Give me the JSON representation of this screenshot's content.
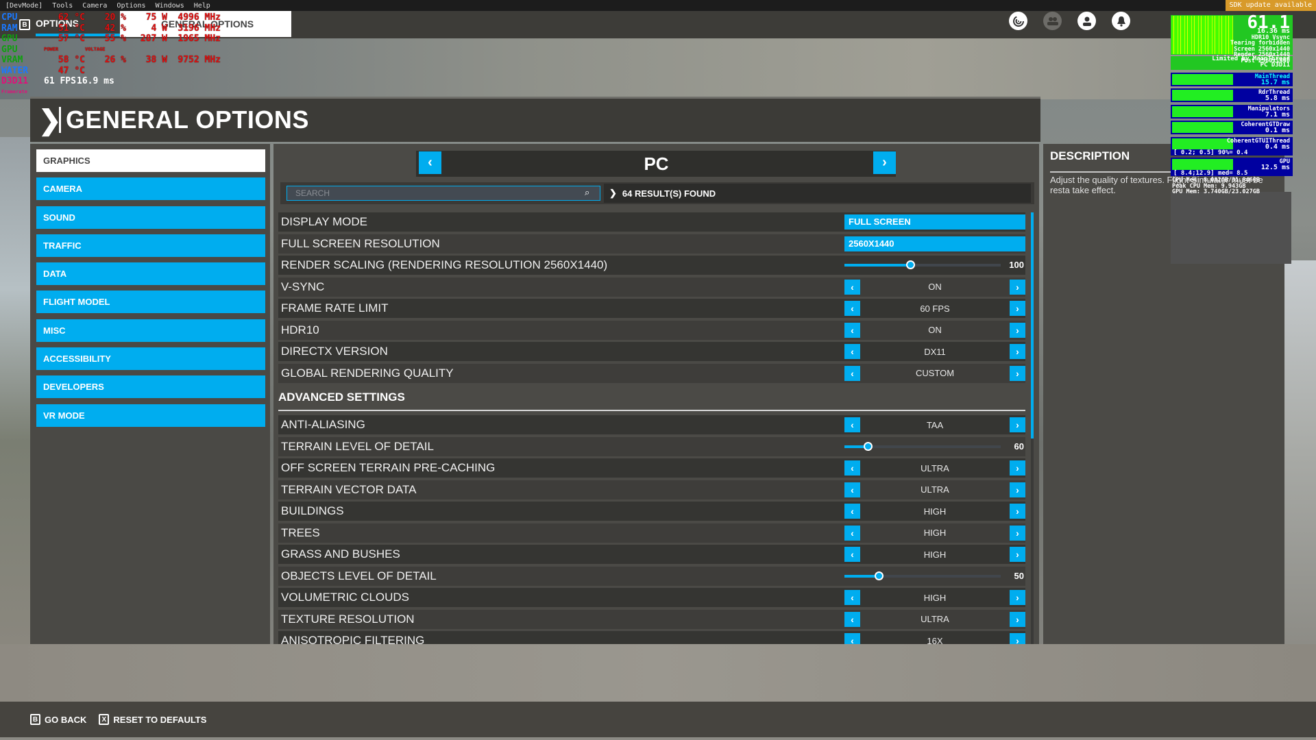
{
  "menubar": {
    "items": [
      "[DevMode]",
      "Tools",
      "Camera",
      "Options",
      "Windows",
      "Help"
    ],
    "sdk_notice": "SDK update available"
  },
  "breadcrumb": {
    "back_key": "B",
    "level1": "OPTIONS",
    "level2": "GENERAL OPTIONS"
  },
  "top_icons": [
    "activity-icon",
    "multiplayer-icon",
    "profile-icon",
    "notifications-icon"
  ],
  "hardware_overlay": {
    "rows": [
      {
        "label": "CPU",
        "values": [
          "62 °C",
          "20 %",
          "75 W",
          "4996 MHz"
        ]
      },
      {
        "label": "RAM",
        "values": [
          "51 °C",
          "42 %",
          "4 W",
          "3196 MHz"
        ]
      },
      {
        "label": "GPU",
        "values": [
          "57 °C",
          "55 %",
          "287 W",
          "1965 MHz"
        ]
      },
      {
        "label": "GPU",
        "values": [
          "POWER",
          "VOLTAGE"
        ]
      },
      {
        "label": "VRAM",
        "values": [
          "58 °C",
          "26 %",
          "38 W",
          "9752 MHz"
        ]
      },
      {
        "label": "WATER",
        "values": [
          "47 °C"
        ]
      },
      {
        "label": "D3D11",
        "values": [
          "61 FPS",
          "16.9 ms"
        ]
      }
    ],
    "framerate_label": "Framerate"
  },
  "header": {
    "title": "GENERAL OPTIONS"
  },
  "sidebar": {
    "items": [
      {
        "label": "GRAPHICS",
        "active": true
      },
      {
        "label": "CAMERA"
      },
      {
        "label": "SOUND"
      },
      {
        "label": "TRAFFIC"
      },
      {
        "label": "DATA"
      },
      {
        "label": "FLIGHT MODEL"
      },
      {
        "label": "MISC"
      },
      {
        "label": "ACCESSIBILITY"
      },
      {
        "label": "DEVELOPERS"
      },
      {
        "label": "VR MODE"
      }
    ]
  },
  "main": {
    "platform_title": "PC",
    "search_placeholder": "SEARCH",
    "results": "64 RESULT(S) FOUND",
    "settings": [
      {
        "label": "DISPLAY MODE",
        "type": "dropdown",
        "value": "FULL SCREEN"
      },
      {
        "label": "FULL SCREEN RESOLUTION",
        "type": "dropdown",
        "value": "2560X1440"
      },
      {
        "label": "RENDER SCALING (RENDERING RESOLUTION 2560X1440)",
        "type": "slider",
        "value": "100",
        "fraction": 0.42
      },
      {
        "label": "V-SYNC",
        "type": "stepper",
        "value": "ON"
      },
      {
        "label": "FRAME RATE LIMIT",
        "type": "stepper",
        "value": "60 FPS"
      },
      {
        "label": "HDR10",
        "type": "stepper",
        "value": "ON"
      },
      {
        "label": "DIRECTX VERSION",
        "type": "stepper",
        "value": "DX11"
      },
      {
        "label": "GLOBAL RENDERING QUALITY",
        "type": "stepper",
        "value": "CUSTOM"
      }
    ],
    "advanced_title": "ADVANCED SETTINGS",
    "advanced": [
      {
        "label": "ANTI-ALIASING",
        "type": "stepper",
        "value": "TAA"
      },
      {
        "label": "TERRAIN LEVEL OF DETAIL",
        "type": "slider",
        "value": "60",
        "fraction": 0.15
      },
      {
        "label": "OFF SCREEN TERRAIN PRE-CACHING",
        "type": "stepper",
        "value": "ULTRA"
      },
      {
        "label": "TERRAIN VECTOR DATA",
        "type": "stepper",
        "value": "ULTRA"
      },
      {
        "label": "BUILDINGS",
        "type": "stepper",
        "value": "HIGH"
      },
      {
        "label": "TREES",
        "type": "stepper",
        "value": "HIGH"
      },
      {
        "label": "GRASS AND BUSHES",
        "type": "stepper",
        "value": "HIGH"
      },
      {
        "label": "OBJECTS LEVEL OF DETAIL",
        "type": "slider",
        "value": "50",
        "fraction": 0.22
      },
      {
        "label": "VOLUMETRIC CLOUDS",
        "type": "stepper",
        "value": "HIGH"
      },
      {
        "label": "TEXTURE RESOLUTION",
        "type": "stepper",
        "value": "ULTRA"
      },
      {
        "label": "ANISOTROPIC FILTERING",
        "type": "stepper",
        "value": "16X"
      }
    ]
  },
  "description": {
    "title": "DESCRIPTION",
    "text": "Adjust the quality of textures. Flight Simulator must be resta take effect."
  },
  "perf_overlay": {
    "fps": "61.1",
    "frame_time": "16.36 ms",
    "info": [
      "HDR10 Vsync",
      "Tearing forbidden",
      "Screen 2560x1440",
      "Render 2560x1440",
      "Post 2560x1440"
    ],
    "limited": [
      "Limited by MainThread",
      "PC D3D11"
    ],
    "threads": [
      {
        "name": "MainThread",
        "value": "15.7 ms"
      },
      {
        "name": "RdrThread",
        "value": "5.8 ms"
      },
      {
        "name": "Manipulators",
        "value": "7.1 ms"
      },
      {
        "name": "CoherentGTDraw",
        "value": "0.1 ms"
      },
      {
        "name": "CoherentGTUIThread",
        "value": "0.4 ms",
        "range": "[ 0.2; 0.5] 90%= 0.4"
      },
      {
        "name": "GPU",
        "value": "12.5 ms",
        "range": "[ 8.4;12.9] med= 8.5"
      }
    ],
    "memory": [
      "CPU Mem: 8.082GB/31.846GB",
      "Peak CPU Mem: 9.943GB",
      "GPU Mem: 3.740GB/23.027GB"
    ]
  },
  "bottom_bar": {
    "go_back_key": "B",
    "go_back": "GO BACK",
    "reset_key": "X",
    "reset": "RESET TO DEFAULTS"
  }
}
